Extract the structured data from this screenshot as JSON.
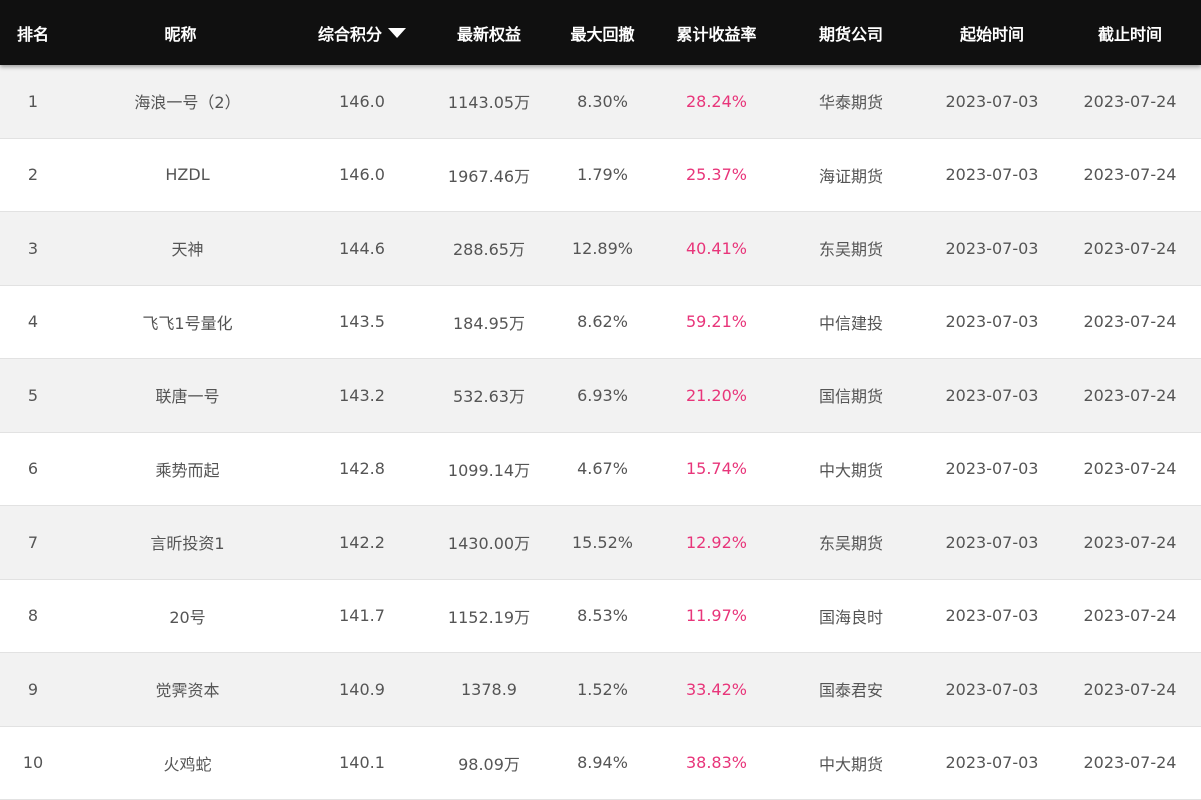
{
  "table": {
    "headers": {
      "rank": "排名",
      "name": "昵称",
      "score": "综合积分",
      "equity": "最新权益",
      "drawdown": "最大回撤",
      "return_rate": "累计收益率",
      "company": "期货公司",
      "start": "起始时间",
      "end": "截止时间"
    },
    "sort_icon": "triangle-down-icon",
    "colors": {
      "header_bg": "#101010",
      "header_text": "#ffffff",
      "row_odd": "#f2f2f2",
      "row_even": "#ffffff",
      "return_rate_text": "#e8357a",
      "cell_text": "#555555"
    },
    "rows": [
      {
        "rank": "1",
        "name": "海浪一号（2）",
        "score": "146.0",
        "equity": "1143.05万",
        "drawdown": "8.30%",
        "return_rate": "28.24%",
        "company": "华泰期货",
        "start": "2023-07-03",
        "end": "2023-07-24"
      },
      {
        "rank": "2",
        "name": "HZDL",
        "score": "146.0",
        "equity": "1967.46万",
        "drawdown": "1.79%",
        "return_rate": "25.37%",
        "company": "海证期货",
        "start": "2023-07-03",
        "end": "2023-07-24"
      },
      {
        "rank": "3",
        "name": "天神",
        "score": "144.6",
        "equity": "288.65万",
        "drawdown": "12.89%",
        "return_rate": "40.41%",
        "company": "东吴期货",
        "start": "2023-07-03",
        "end": "2023-07-24"
      },
      {
        "rank": "4",
        "name": "飞飞1号量化",
        "score": "143.5",
        "equity": "184.95万",
        "drawdown": "8.62%",
        "return_rate": "59.21%",
        "company": "中信建投",
        "start": "2023-07-03",
        "end": "2023-07-24"
      },
      {
        "rank": "5",
        "name": "联唐一号",
        "score": "143.2",
        "equity": "532.63万",
        "drawdown": "6.93%",
        "return_rate": "21.20%",
        "company": "国信期货",
        "start": "2023-07-03",
        "end": "2023-07-24"
      },
      {
        "rank": "6",
        "name": "乘势而起",
        "score": "142.8",
        "equity": "1099.14万",
        "drawdown": "4.67%",
        "return_rate": "15.74%",
        "company": "中大期货",
        "start": "2023-07-03",
        "end": "2023-07-24"
      },
      {
        "rank": "7",
        "name": "言昕投资1",
        "score": "142.2",
        "equity": "1430.00万",
        "drawdown": "15.52%",
        "return_rate": "12.92%",
        "company": "东吴期货",
        "start": "2023-07-03",
        "end": "2023-07-24"
      },
      {
        "rank": "8",
        "name": "20号",
        "score": "141.7",
        "equity": "1152.19万",
        "drawdown": "8.53%",
        "return_rate": "11.97%",
        "company": "国海良时",
        "start": "2023-07-03",
        "end": "2023-07-24"
      },
      {
        "rank": "9",
        "name": "觉霁资本",
        "score": "140.9",
        "equity": "1378.9",
        "drawdown": "1.52%",
        "return_rate": "33.42%",
        "company": "国泰君安",
        "start": "2023-07-03",
        "end": "2023-07-24"
      },
      {
        "rank": "10",
        "name": "火鸡蛇",
        "score": "140.1",
        "equity": "98.09万",
        "drawdown": "8.94%",
        "return_rate": "38.83%",
        "company": "中大期货",
        "start": "2023-07-03",
        "end": "2023-07-24"
      }
    ]
  }
}
